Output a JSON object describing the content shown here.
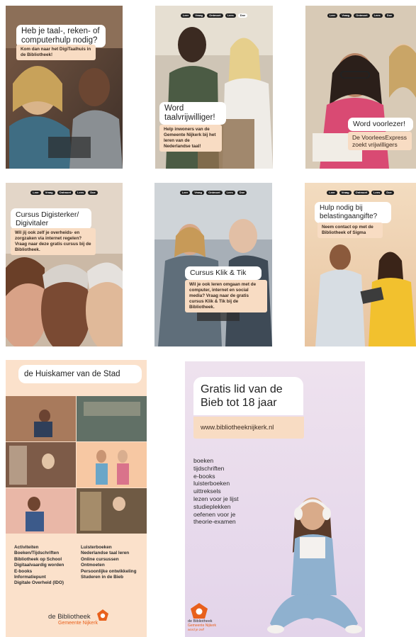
{
  "pill_labels": [
    "Leer",
    "Vraag",
    "Ontmoet",
    "Lees",
    "Doe"
  ],
  "posters": [
    {
      "title": "Heb je taal-, reken- of computerhulp nodig?",
      "subtitle": "Kom dan naar het DigiTaalhuis in de Bibliotheek!"
    },
    {
      "title": "Word taalvrijwilliger!",
      "subtitle": "Help inwoners van de Gemeente Nijkerk bij het leren van de Nederlandse taal!"
    },
    {
      "title": "Word voorlezer!",
      "subtitle": "De VoorleesExpress zoekt vrijwilligers"
    },
    {
      "title": "Cursus Digisterker/ Digivitaler",
      "subtitle": "Wil jij ook zelf je overheids- en zorgzaken via internet regelen? Vraag naar deze gratis cursus bij de Bibliotheek."
    },
    {
      "title": "Cursus Klik & Tik",
      "subtitle": "Wil je ook leren omgaan met de computer, internet en social media? Vraag naar de gratis cursus Klik & Tik bij de Bibliotheek."
    },
    {
      "title": "Hulp nodig bij belastingaangifte?",
      "subtitle": "Neem contact op met de Bibliotheek of Sigma"
    }
  ],
  "huiskamer": {
    "title": "de Huiskamer van de Stad",
    "col1": [
      "Activiteiten",
      "Boeken/Tijdschriften",
      "Bibliotheek op School",
      "Digitaalvaardig worden",
      "E-books",
      "Informatiepunt",
      "Digitale Overheid (IDO)"
    ],
    "col2": [
      "Luisterboeken",
      "Nederlandse taal leren",
      "Online cursussen",
      "Ontmoeten",
      "Persoonlijke ontwikkeling",
      "Studeren in de Bieb"
    ],
    "logo_line1": "de Bibliotheek",
    "logo_line2": "Gemeente Nijkerk"
  },
  "gratis": {
    "title": "Gratis lid van de Bieb tot 18 jaar",
    "url": "www.bibliotheeknijkerk.nl",
    "items": [
      "boeken",
      "tijdschriften",
      "e-books",
      "luisterboeken",
      "uittreksels",
      "lezen voor je lijst",
      "studieplekken",
      "oefenen voor je",
      "theorie-examen"
    ],
    "logo_line1": "de Bibliotheek",
    "logo_line2": "Gemeente Nijkerk",
    "logo_tagline": "word je zelf"
  },
  "colors": {
    "brand_orange": "#e8601c",
    "peach": "#f8dcc3",
    "lilac": "#e3d4ea"
  }
}
